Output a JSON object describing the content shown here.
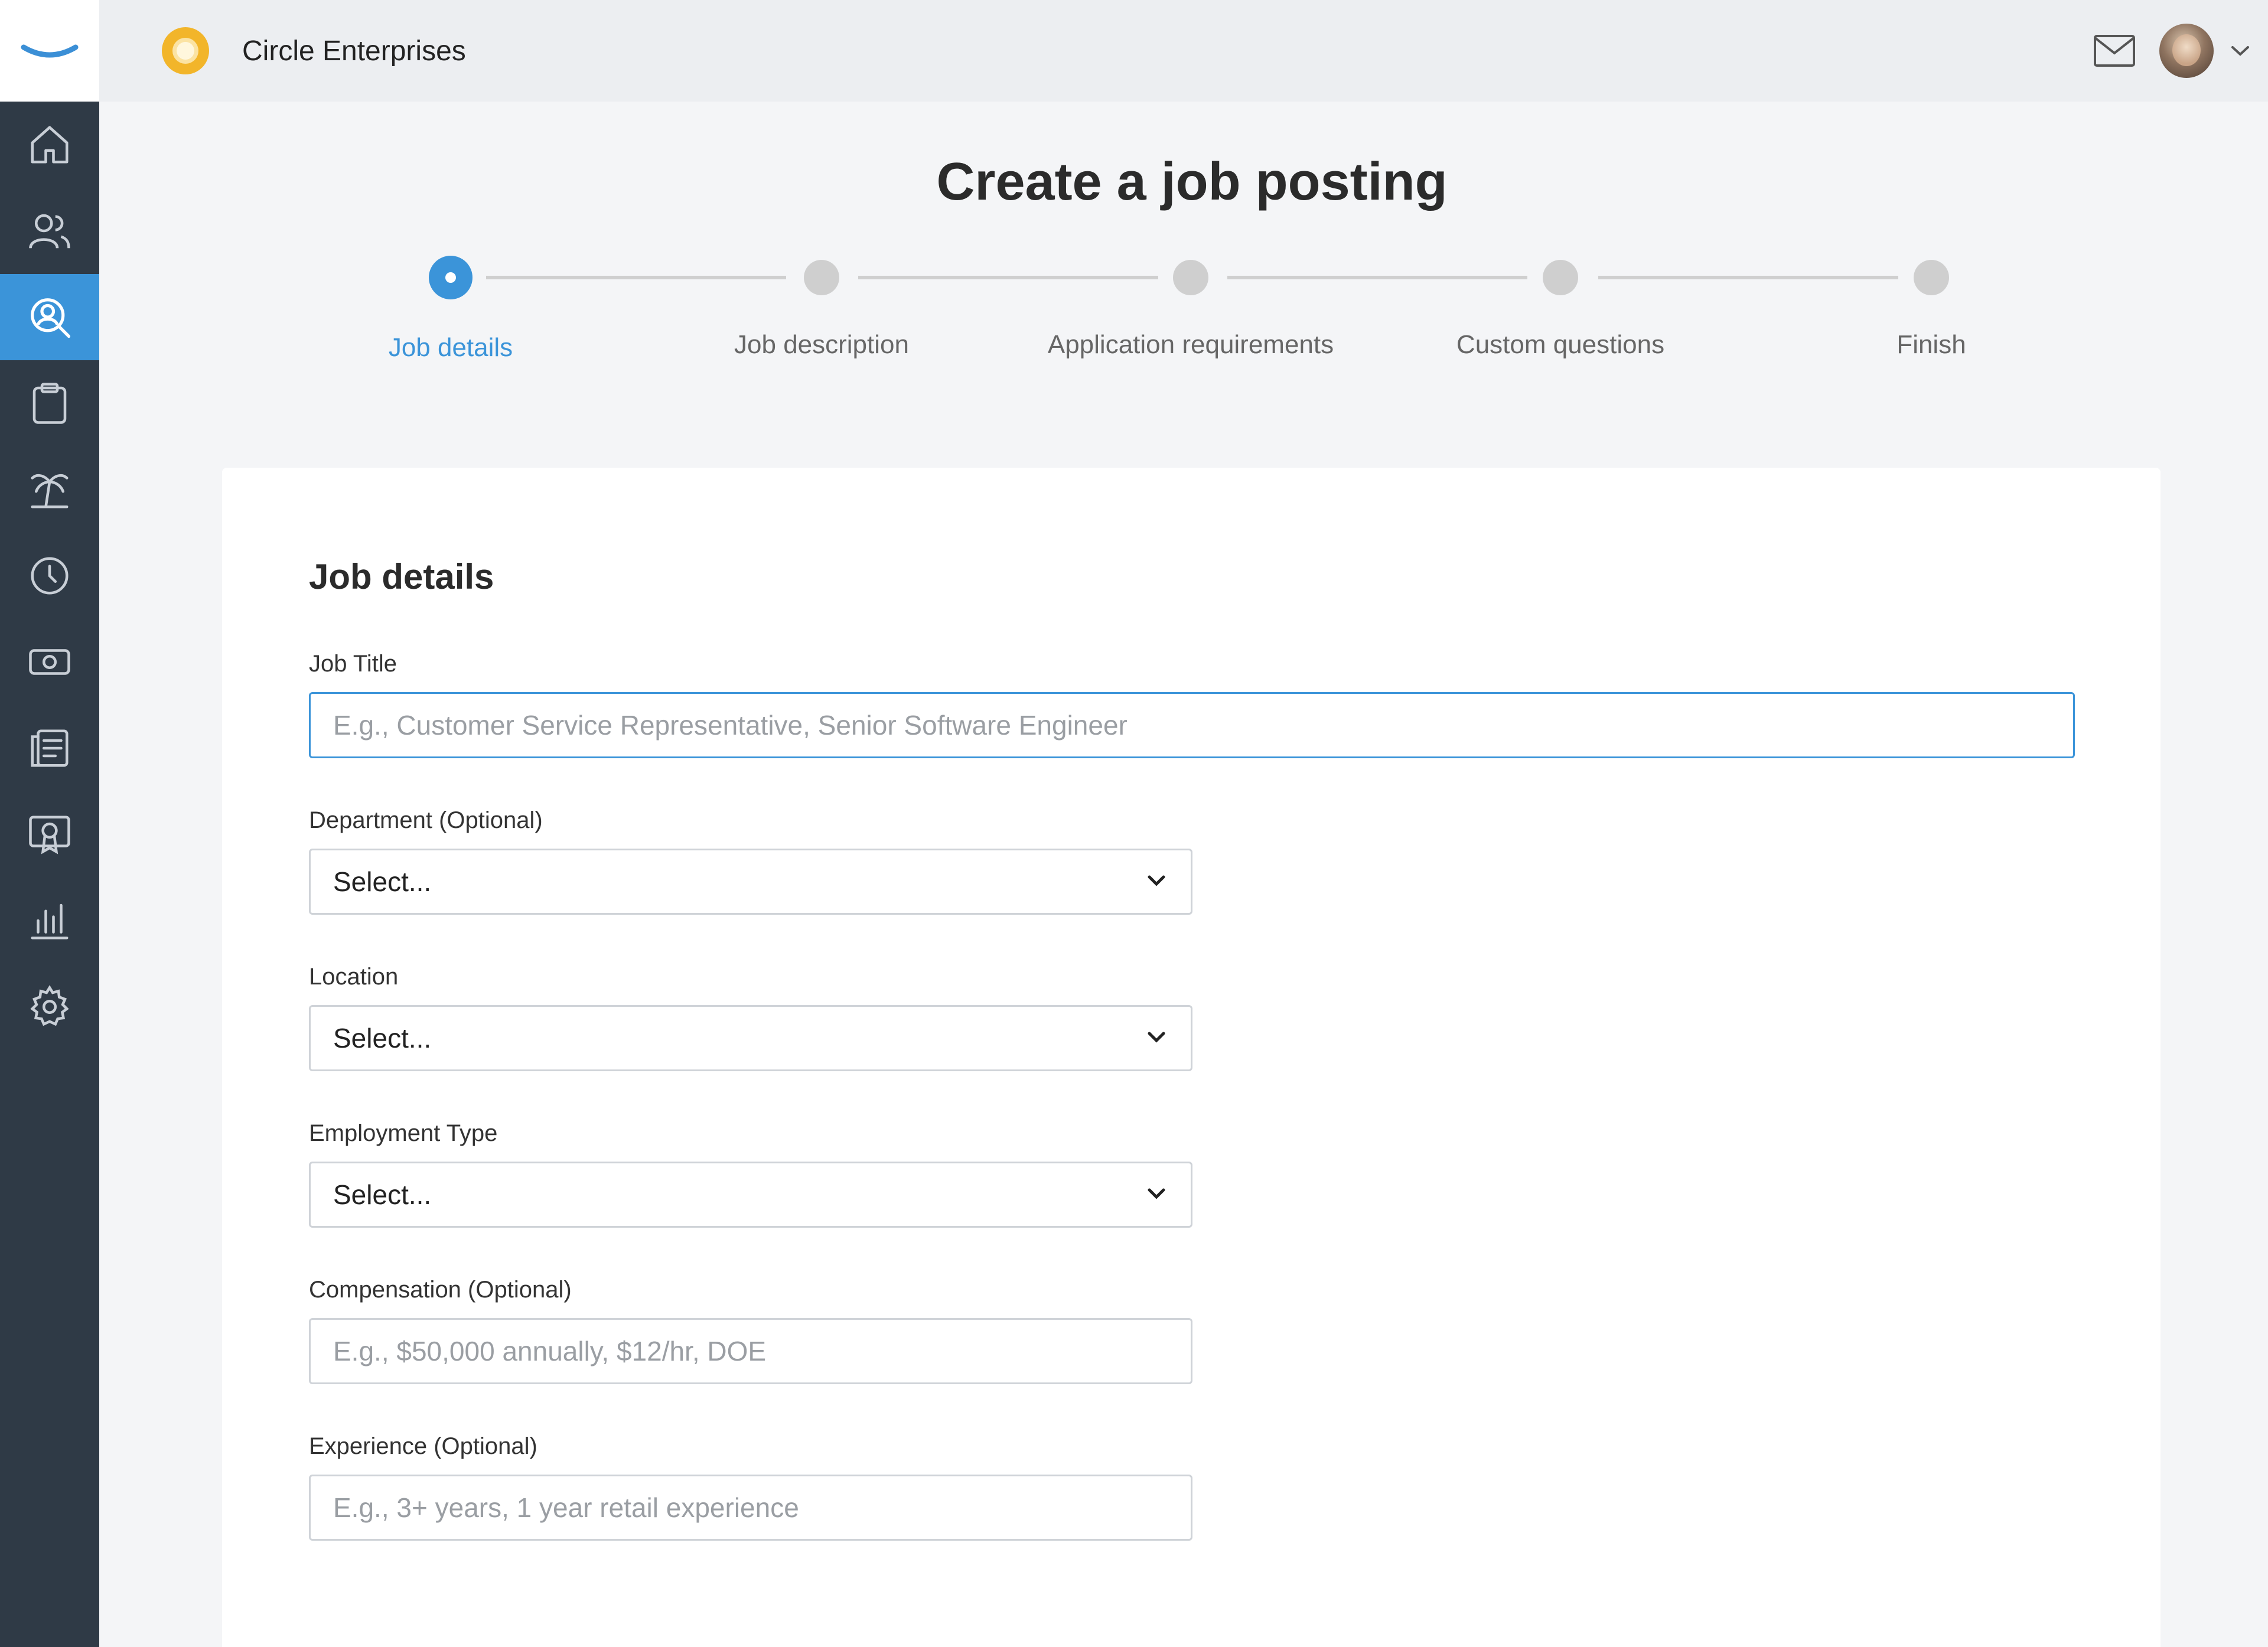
{
  "brand": {
    "icon": "brand-smile-logo"
  },
  "sidebar": {
    "items": [
      {
        "icon": "home-icon",
        "active": false
      },
      {
        "icon": "people-icon",
        "active": false
      },
      {
        "icon": "recruiting-search-icon",
        "active": true
      },
      {
        "icon": "clipboard-icon",
        "active": false
      },
      {
        "icon": "palm-tree-icon",
        "active": false
      },
      {
        "icon": "clock-icon",
        "active": false
      },
      {
        "icon": "money-icon",
        "active": false
      },
      {
        "icon": "documents-icon",
        "active": false
      },
      {
        "icon": "certificate-icon",
        "active": false
      },
      {
        "icon": "bar-chart-icon",
        "active": false
      },
      {
        "icon": "gear-icon",
        "active": false
      }
    ]
  },
  "topbar": {
    "company_name": "Circle Enterprises",
    "company_logo_color": "#f2b52a",
    "mail_icon": "mail-icon",
    "avatar": "user-avatar",
    "menu_icon": "chevron-down-icon"
  },
  "page": {
    "title": "Create a job posting"
  },
  "stepper": {
    "steps": [
      {
        "label": "Job details",
        "active": true
      },
      {
        "label": "Job description",
        "active": false
      },
      {
        "label": "Application requirements",
        "active": false
      },
      {
        "label": "Custom questions",
        "active": false
      },
      {
        "label": "Finish",
        "active": false
      }
    ]
  },
  "form": {
    "section_title": "Job details",
    "job_title": {
      "label": "Job Title",
      "value": "",
      "placeholder": "E.g., Customer Service Representative, Senior Software Engineer"
    },
    "department": {
      "label": "Department (Optional)",
      "value": "Select..."
    },
    "location": {
      "label": "Location",
      "value": "Select..."
    },
    "employment_type": {
      "label": "Employment Type",
      "value": "Select..."
    },
    "compensation": {
      "label": "Compensation (Optional)",
      "value": "",
      "placeholder": "E.g., $50,000 annually, $12/hr, DOE"
    },
    "experience": {
      "label": "Experience (Optional)",
      "value": "",
      "placeholder": "E.g., 3+ years, 1 year retail experience"
    }
  },
  "colors": {
    "accent": "#3b94d9",
    "sidebar_bg": "#2f3a46",
    "inactive_step": "#cfcfcf"
  }
}
